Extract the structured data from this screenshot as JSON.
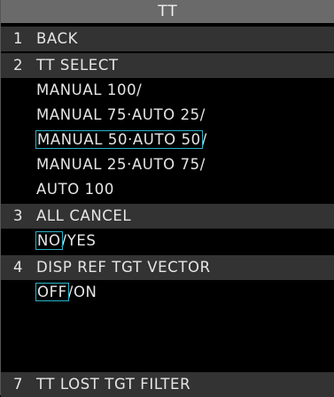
{
  "title": "TT",
  "menu": {
    "item1": {
      "num": "1",
      "label": "BACK"
    },
    "item2": {
      "num": "2",
      "label": "TT SELECT",
      "options": [
        "MANUAL 100/",
        "MANUAL 75·AUTO 25/",
        "MANUAL 50·AUTO 50",
        "/",
        "MANUAL 25·AUTO 75/",
        "AUTO 100"
      ]
    },
    "item3": {
      "num": "3",
      "label": "ALL CANCEL",
      "opt_selected": "NO",
      "opt_rest": "/YES"
    },
    "item4": {
      "num": "4",
      "label": "DISP REF TGT VECTOR",
      "opt_selected": "OFF",
      "opt_rest": "/ON"
    },
    "item7": {
      "num": "7",
      "label": "TT LOST TGT FILTER"
    }
  },
  "colors": {
    "selection_outline": "#2ab3c8",
    "title_bg": "#6a6a6a",
    "header_row_bg": "#333333"
  }
}
